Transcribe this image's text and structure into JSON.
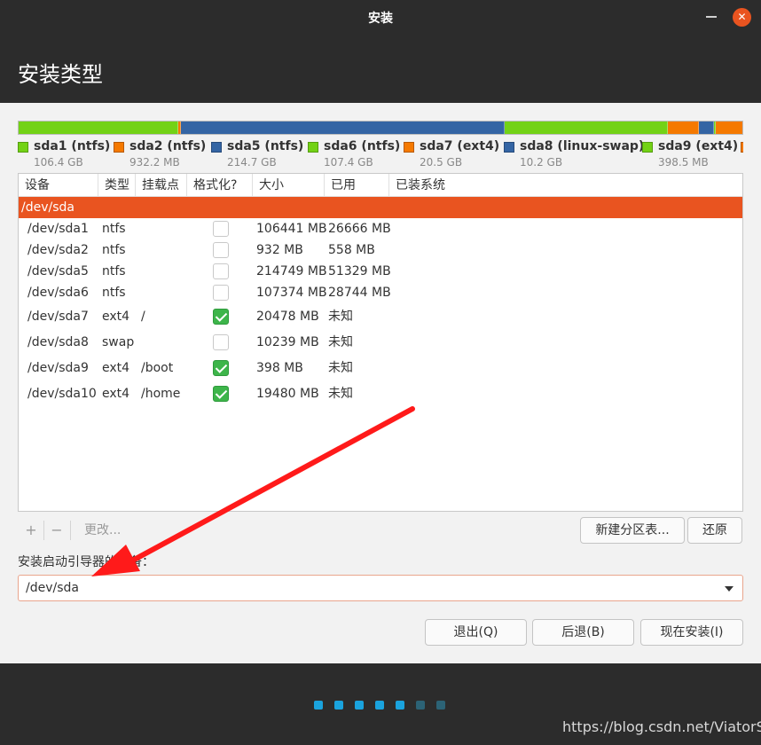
{
  "window": {
    "title": "安装",
    "minimize_icon": "minimize-icon",
    "close_icon": "close-icon",
    "close_glyph": "✕"
  },
  "header": {
    "title": "安装类型"
  },
  "colors": {
    "accent": "#e95420",
    "ntfs": "#73d216",
    "ntfs_alt": "#f57900",
    "ext4": "#f57900",
    "swap": "#3465a4",
    "check_on": "#3db54a",
    "dot_active": "#1aa3de",
    "dot_inactive": "#2c6376"
  },
  "disk_usage": [
    {
      "name": "sda1 (ntfs)",
      "size": "106.4 GB",
      "color": "#73d216"
    },
    {
      "name": "sda2 (ntfs)",
      "size": "932.2 MB",
      "color": "#f57900"
    },
    {
      "name": "sda5 (ntfs)",
      "size": "214.7 GB",
      "color": "#3465a4"
    },
    {
      "name": "sda6 (ntfs)",
      "size": "107.4 GB",
      "color": "#73d216"
    },
    {
      "name": "sda7 (ext4)",
      "size": "20.5 GB",
      "color": "#f57900"
    },
    {
      "name": "sda8 (linux-swap)",
      "size": "10.2 GB",
      "color": "#3465a4"
    },
    {
      "name": "sda9 (ext4)",
      "size": "398.5 MB",
      "color": "#73d216"
    },
    {
      "name": "",
      "size": "",
      "color": "#f57900"
    }
  ],
  "table": {
    "headers": [
      "设备",
      "类型",
      "挂载点",
      "格式化?",
      "大小",
      "已用",
      "已装系统"
    ],
    "device": "/dev/sda",
    "rows": [
      {
        "device": "/dev/sda1",
        "type": "ntfs",
        "mount": "",
        "format": false,
        "size": "106441 MB",
        "used": "26666 MB",
        "system": ""
      },
      {
        "device": "/dev/sda2",
        "type": "ntfs",
        "mount": "",
        "format": false,
        "size": "932 MB",
        "used": "558 MB",
        "system": ""
      },
      {
        "device": "/dev/sda5",
        "type": "ntfs",
        "mount": "",
        "format": false,
        "size": "214749 MB",
        "used": "51329 MB",
        "system": ""
      },
      {
        "device": "/dev/sda6",
        "type": "ntfs",
        "mount": "",
        "format": false,
        "size": "107374 MB",
        "used": "28744 MB",
        "system": ""
      },
      {
        "device": "/dev/sda7",
        "type": "ext4",
        "mount": "/",
        "format": true,
        "size": "20478 MB",
        "used": "未知",
        "system": ""
      },
      {
        "device": "/dev/sda8",
        "type": "swap",
        "mount": "",
        "format": false,
        "size": "10239 MB",
        "used": "未知",
        "system": ""
      },
      {
        "device": "/dev/sda9",
        "type": "ext4",
        "mount": "/boot",
        "format": true,
        "size": "398 MB",
        "used": "未知",
        "system": ""
      },
      {
        "device": "/dev/sda10",
        "type": "ext4",
        "mount": "/home",
        "format": true,
        "size": "19480 MB",
        "used": "未知",
        "system": ""
      }
    ]
  },
  "toolbar": {
    "add": "+",
    "remove": "−",
    "change": "更改...",
    "new_table": "新建分区表...",
    "revert": "还原"
  },
  "bootloader": {
    "label": "安装启动引导器的设备：",
    "value": "/dev/sda"
  },
  "buttons": {
    "quit": "退出(Q)",
    "back": "后退(B)",
    "install": "现在安装(I)"
  },
  "progress": {
    "total_steps": 7,
    "completed_steps": 5
  },
  "watermark": "https://blog.csdn.net/ViatorSun"
}
